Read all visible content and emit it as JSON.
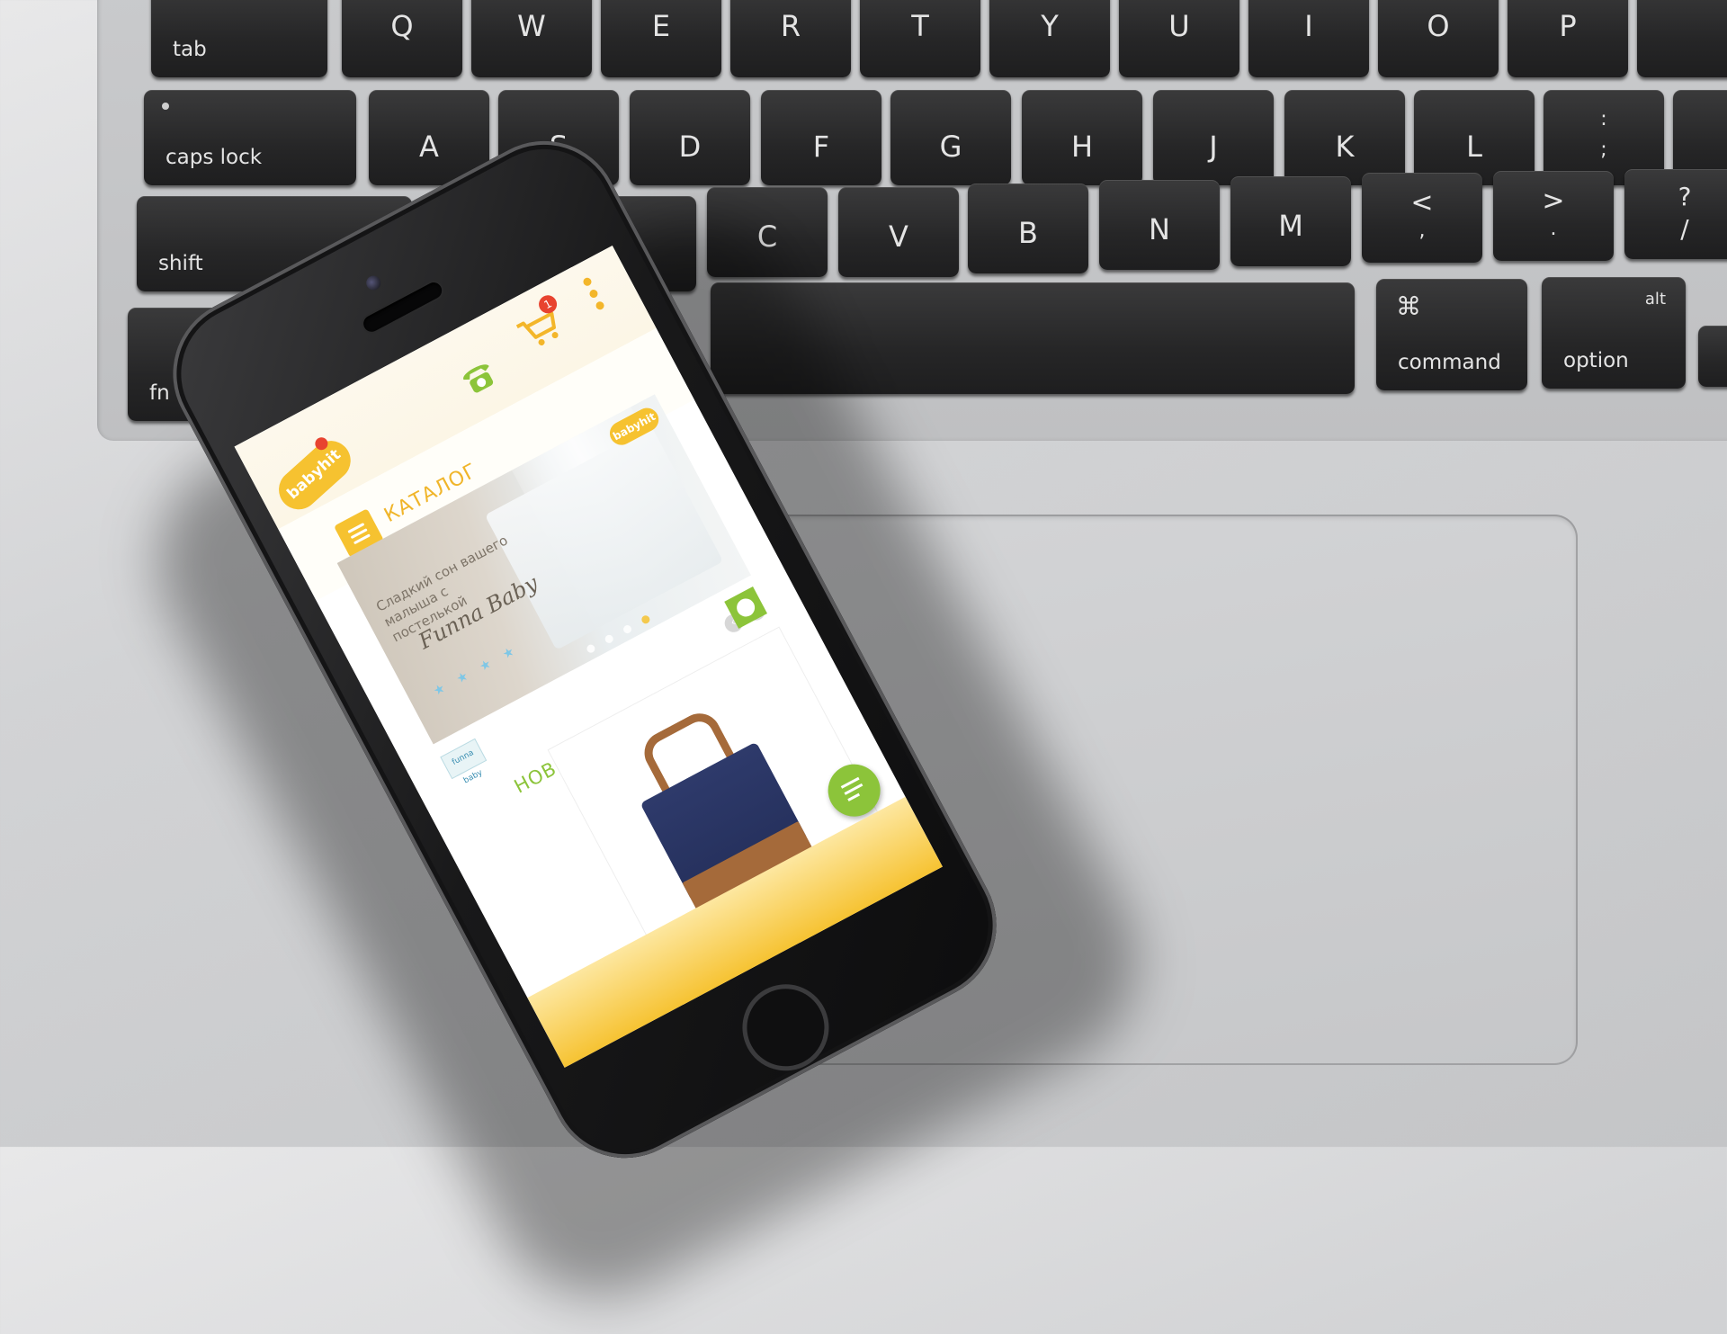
{
  "keyboard": {
    "rows": [
      [
        "tab",
        "Q",
        "W",
        "E",
        "R",
        "T",
        "Y",
        "U",
        "I",
        "O",
        "P"
      ],
      [
        "caps lock",
        "A",
        "S",
        "D",
        "F",
        "G",
        "H",
        "J",
        "K",
        "L"
      ],
      [
        "shift",
        "C",
        "V",
        "B",
        "N",
        "M"
      ],
      [
        "fn",
        "command",
        "alt",
        "option"
      ]
    ],
    "keys": {
      "tab": "tab",
      "caps": "caps lock",
      "shift": "shift",
      "fn": "fn",
      "q": "Q",
      "w": "W",
      "e": "E",
      "r": "R",
      "t": "T",
      "y": "Y",
      "u": "U",
      "i": "I",
      "o": "O",
      "p": "P",
      "a": "A",
      "s": "S",
      "d": "D",
      "f": "F",
      "g": "G",
      "h": "H",
      "j": "J",
      "k": "K",
      "l": "L",
      "semicolon_top": ":",
      "semicolon_bottom": ";",
      "c": "C",
      "v": "V",
      "b": "B",
      "n": "N",
      "m": "M",
      "comma_top": "<",
      "comma_bottom": ",",
      "period_top": ">",
      "period_bottom": ".",
      "slash_top": "?",
      "slash_bottom": "/",
      "command_symbol": "⌘",
      "command": "command",
      "alt": "alt",
      "option": "option"
    }
  },
  "phone": {
    "app": {
      "logo_text": "babyhit",
      "cart_count": "1",
      "catalog_label": "КАТАЛОГ",
      "banner": {
        "text": "Сладкий сон вашего малыша с постелькой",
        "brand": "Funna Baby",
        "logo_text": "babyhit"
      },
      "arrows": {
        "prev": "‹",
        "next": "›"
      },
      "brand_badge": "funna baby",
      "new_products_label": "НОВИНКИ"
    }
  },
  "colors": {
    "accent_yellow": "#f6c230",
    "accent_green": "#8cc43a",
    "badge_red": "#e8432f",
    "key_black": "#262627"
  },
  "icons": [
    "phone-icon",
    "cart-icon",
    "more-icon",
    "menu-icon",
    "chat-icon",
    "new-badge-icon"
  ]
}
